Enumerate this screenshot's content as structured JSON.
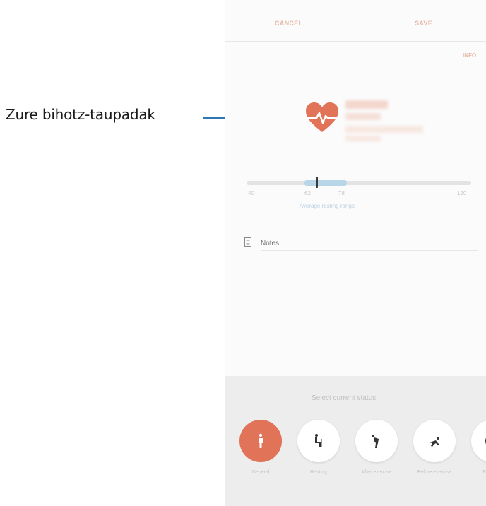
{
  "callout": {
    "label": "Zure bihotz-taupadak"
  },
  "toolbar": {
    "cancel_label": "CANCEL",
    "save_label": "SAVE"
  },
  "info_link": "INFO",
  "measurement": {
    "bpm_value": "",
    "range": {
      "ticks": [
        "40",
        "62",
        "78",
        "120"
      ],
      "average_label": "Average resting range",
      "marker_value": 68
    }
  },
  "note": {
    "placeholder": "Notes"
  },
  "status": {
    "title": "Select current status",
    "options": [
      {
        "label": "General",
        "icon": "standing-person-icon",
        "active": true
      },
      {
        "label": "Resting",
        "icon": "sitting-person-icon",
        "active": false
      },
      {
        "label": "After exercise",
        "icon": "bending-person-icon",
        "active": false
      },
      {
        "label": "Before exercise",
        "icon": "starting-runner-icon",
        "active": false
      },
      {
        "label": "Fatigued",
        "icon": "face-icon",
        "active": false
      }
    ]
  },
  "colors": {
    "accent": "#e07358",
    "callout_line": "#2f78b5",
    "range_avg": "#b9d6e8"
  }
}
